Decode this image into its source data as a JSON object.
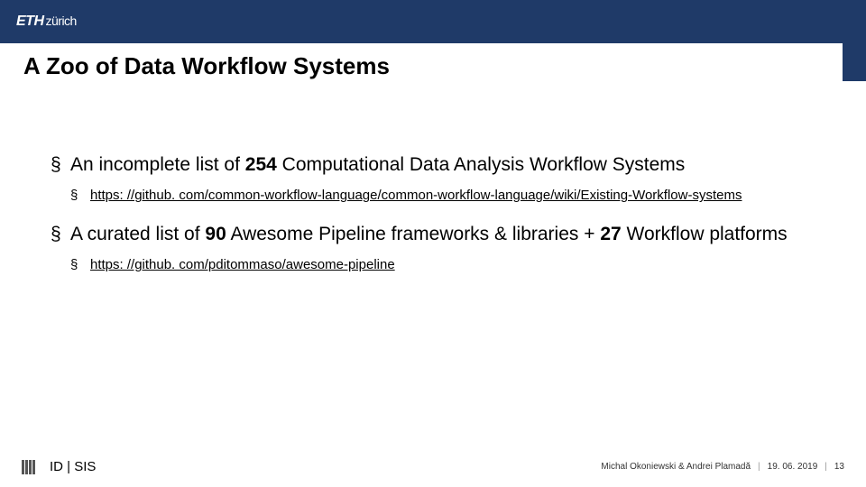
{
  "header": {
    "logo_main": "ETH",
    "logo_sub": "zürich"
  },
  "title": "A Zoo of Data Workflow Systems",
  "bullets": [
    {
      "pre": "An incomplete list of ",
      "bold": "254",
      "post": " Computational Data Analysis Workflow Systems",
      "sub": {
        "link": "https: //github. com/common-workflow-language/common-workflow-language/wiki/Existing-Workflow-systems"
      }
    },
    {
      "pre": "A curated list of ",
      "bold": "90",
      "mid": " Awesome Pipeline frameworks & libraries + ",
      "bold2": "27",
      "post": " Workflow platforms",
      "sub": {
        "link": "https: //github. com/pditommaso/awesome-pipeline"
      }
    }
  ],
  "footer": {
    "dept": "ID | SIS",
    "authors": "Michal Okoniewski & Andrei Plamadă",
    "date": "19. 06. 2019",
    "page": "13"
  }
}
